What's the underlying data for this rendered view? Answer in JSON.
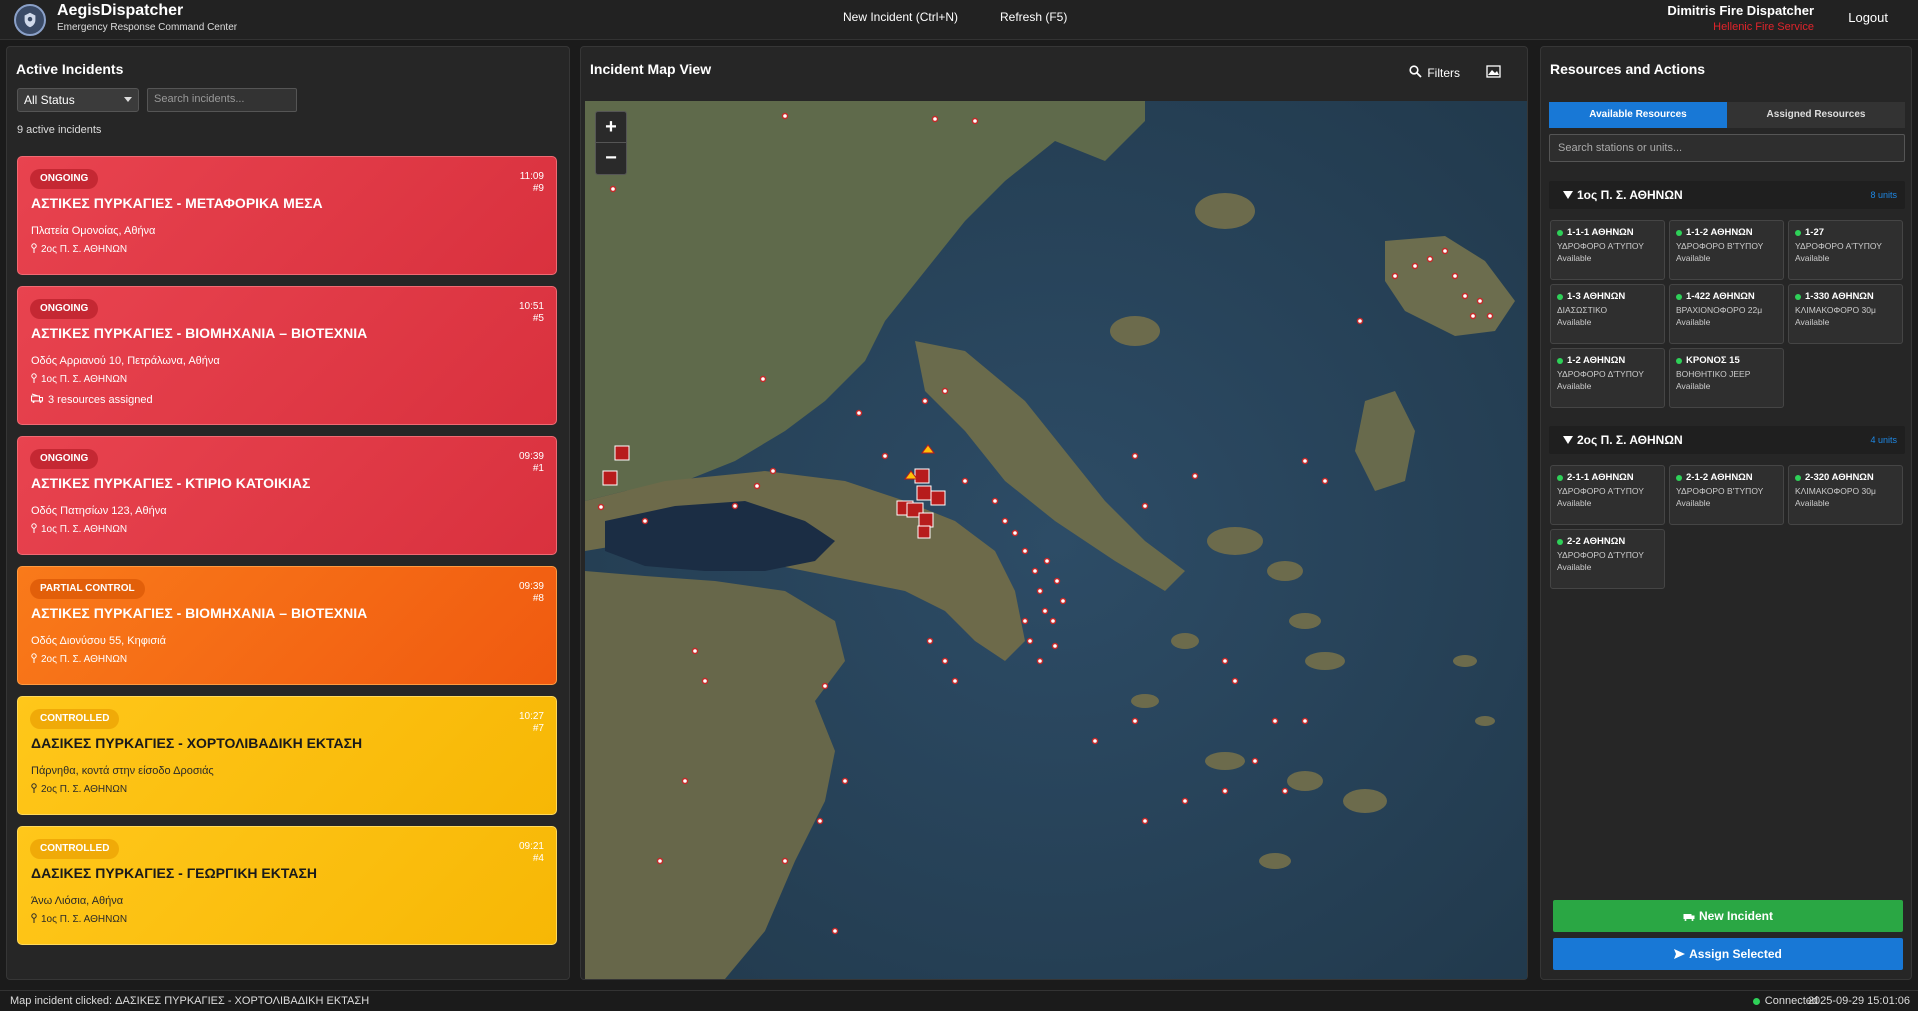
{
  "app": {
    "title": "AegisDispatcher",
    "subtitle": "Emergency Response Command Center"
  },
  "toolbar": {
    "new_incident": "New Incident (Ctrl+N)",
    "refresh": "Refresh (F5)",
    "logout": "Logout"
  },
  "user": {
    "name": "Dimitris Fire Dispatcher",
    "org": "Hellenic Fire Service"
  },
  "incidents_panel": {
    "title": "Active Incidents",
    "status_filter": "All Status",
    "search_placeholder": "Search incidents...",
    "count_text": "9 active incidents",
    "items": [
      {
        "status": "ONGOING",
        "time": "11:09",
        "number": "#9",
        "title": "ΑΣΤΙΚΕΣ ΠΥΡΚΑΓΙΕΣ - ΜΕΤΑΦΟΡΙΚΑ ΜΕΣΑ",
        "address": "Πλατεία Ομονοίας, Αθήνα",
        "station": "2ος Π. Σ. ΑΘΗΝΩΝ",
        "resources": "",
        "color": "red"
      },
      {
        "status": "ONGOING",
        "time": "10:51",
        "number": "#5",
        "title": "ΑΣΤΙΚΕΣ ΠΥΡΚΑΓΙΕΣ - ΒΙΟΜΗΧΑΝΙΑ – ΒΙΟΤΕΧΝΙΑ",
        "address": "Οδός Αρριανού 10, Πετράλωνα, Αθήνα",
        "station": "1ος Π. Σ. ΑΘΗΝΩΝ",
        "resources": "3 resources assigned",
        "color": "red"
      },
      {
        "status": "ONGOING",
        "time": "09:39",
        "number": "#1",
        "title": "ΑΣΤΙΚΕΣ ΠΥΡΚΑΓΙΕΣ - ΚΤΙΡΙΟ ΚΑΤΟΙΚΙΑΣ",
        "address": "Οδός Πατησίων 123, Αθήνα",
        "station": "1ος Π. Σ. ΑΘΗΝΩΝ",
        "resources": "",
        "color": "red"
      },
      {
        "status": "PARTIAL CONTROL",
        "time": "09:39",
        "number": "#8",
        "title": "ΑΣΤΙΚΕΣ ΠΥΡΚΑΓΙΕΣ - ΒΙΟΜΗΧΑΝΙΑ – ΒΙΟΤΕΧΝΙΑ",
        "address": "Οδός Διονύσου 55, Κηφισιά",
        "station": "2ος Π. Σ. ΑΘΗΝΩΝ",
        "resources": "",
        "color": "orange"
      },
      {
        "status": "CONTROLLED",
        "time": "10:27",
        "number": "#7",
        "title": "ΔΑΣΙΚΕΣ ΠΥΡΚΑΓΙΕΣ - ΧΟΡΤΟΛΙΒΑΔΙΚΗ ΕΚΤΑΣΗ",
        "address": "Πάρνηθα, κοντά στην είσοδο Δροσιάς",
        "station": "2ος Π. Σ. ΑΘΗΝΩΝ",
        "resources": "",
        "color": "yellow"
      },
      {
        "status": "CONTROLLED",
        "time": "09:21",
        "number": "#4",
        "title": "ΔΑΣΙΚΕΣ ΠΥΡΚΑΓΙΕΣ - ΓΕΩΡΓΙΚΗ ΕΚΤΑΣΗ",
        "address": "Άνω Λιόσια, Αθήνα",
        "station": "1ος Π. Σ. ΑΘΗΝΩΝ",
        "resources": "",
        "color": "yellow"
      }
    ]
  },
  "map_panel": {
    "title": "Incident Map View",
    "filters": "Filters",
    "zoom_in": "+",
    "zoom_out": "−"
  },
  "resources_panel": {
    "title": "Resources and Actions",
    "tabs": [
      "Available Resources",
      "Assigned Resources"
    ],
    "search_placeholder": "Search stations or units...",
    "groups": [
      {
        "name": "1ος Π. Σ. ΑΘΗΝΩΝ",
        "count": "8 units",
        "units": [
          {
            "name": "1-1-1 ΑΘΗΝΩΝ",
            "type": "ΥΔΡΟΦΟΡΟ Α'ΤΥΠΟΥ",
            "status": "Available"
          },
          {
            "name": "1-1-2 ΑΘΗΝΩΝ",
            "type": "ΥΔΡΟΦΟΡΟ Β'ΤΥΠΟΥ",
            "status": "Available"
          },
          {
            "name": "1-27",
            "type": "ΥΔΡΟΦΟΡΟ Α'ΤΥΠΟΥ",
            "status": "Available"
          },
          {
            "name": "1-3 ΑΘΗΝΩΝ",
            "type": "ΔΙΑΣΩΣΤΙΚΟ",
            "status": "Available"
          },
          {
            "name": "1-422 ΑΘΗΝΩΝ",
            "type": "ΒΡΑΧΙΟΝΟΦΟΡΟ 22μ",
            "status": "Available"
          },
          {
            "name": "1-330 ΑΘΗΝΩΝ",
            "type": "ΚΛΙΜΑΚΟΦΟΡΟ 30μ",
            "status": "Available"
          },
          {
            "name": "1-2 ΑΘΗΝΩΝ",
            "type": "ΥΔΡΟΦΟΡΟ Δ'ΤΥΠΟΥ",
            "status": "Available"
          },
          {
            "name": "ΚΡΟΝΟΣ 15",
            "type": "ΒΟΗΘΗΤΙΚΟ JEEP",
            "status": "Available"
          }
        ]
      },
      {
        "name": "2ος Π. Σ. ΑΘΗΝΩΝ",
        "count": "4 units",
        "units": [
          {
            "name": "2-1-1 ΑΘΗΝΩΝ",
            "type": "ΥΔΡΟΦΟΡΟ Α'ΤΥΠΟΥ",
            "status": "Available"
          },
          {
            "name": "2-1-2 ΑΘΗΝΩΝ",
            "type": "ΥΔΡΟΦΟΡΟ Β'ΤΥΠΟΥ",
            "status": "Available"
          },
          {
            "name": "2-320 ΑΘΗΝΩΝ",
            "type": "ΚΛΙΜΑΚΟΦΟΡΟ 30μ",
            "status": "Available"
          },
          {
            "name": "2-2 ΑΘΗΝΩΝ",
            "type": "ΥΔΡΟΦΟΡΟ Δ'ΤΥΠΟΥ",
            "status": "Available"
          }
        ]
      }
    ],
    "new_incident_button": "New Incident",
    "assign_button": "Assign Selected"
  },
  "statusbar": {
    "message": "Map incident clicked: ΔΑΣΙΚΕΣ ΠΥΡΚΑΓΙΕΣ - ΧΟΡΤΟΛΙΒΑΔΙΚΗ ΕΚΤΑΣΗ",
    "connection": "Connected",
    "datetime": "2025-09-29 15:01:06"
  },
  "colors": {
    "ongoing": "#e23a47",
    "partial": "#f6721a",
    "controlled": "#fdc010",
    "accent": "#1878d6",
    "success": "#2aa744"
  }
}
